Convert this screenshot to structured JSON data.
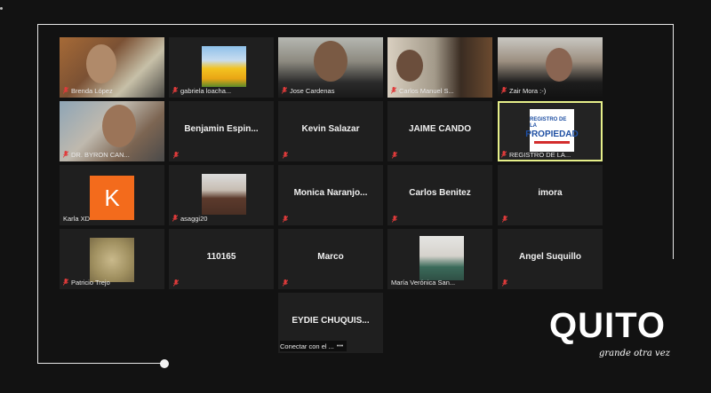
{
  "participants": [
    {
      "name": "Brenda López",
      "display": "",
      "muted": true
    },
    {
      "name": "gabriela loacha...",
      "display": "",
      "muted": true
    },
    {
      "name": "Jose Cardenas",
      "display": "",
      "muted": true
    },
    {
      "name": "Carlos Manuel S...",
      "display": "",
      "muted": true
    },
    {
      "name": "Zair Mora :-)",
      "display": "",
      "muted": true
    },
    {
      "name": "DR. BYRON CAN...",
      "display": "",
      "muted": true
    },
    {
      "name": "",
      "display": "Benjamin  Espin...",
      "muted": true
    },
    {
      "name": "",
      "display": "Kevin Salazar",
      "muted": true
    },
    {
      "name": "",
      "display": "JAIME CANDO",
      "muted": true
    },
    {
      "name": "REGISTRO DE LA...",
      "display": "",
      "muted": true,
      "active_speaker": true
    },
    {
      "name": "Karla XD",
      "display": "",
      "muted": false
    },
    {
      "name": "asaggi20",
      "display": "",
      "muted": true
    },
    {
      "name": "",
      "display": "Monica  Naranjo...",
      "muted": true
    },
    {
      "name": "",
      "display": "Carlos Benitez",
      "muted": true
    },
    {
      "name": "",
      "display": "imora",
      "muted": true
    },
    {
      "name": "Patricio Trejo",
      "display": "",
      "muted": true
    },
    {
      "name": "",
      "display": "110165",
      "muted": true
    },
    {
      "name": "",
      "display": "Marco",
      "muted": true
    },
    {
      "name": "María Verónica San...",
      "display": "",
      "muted": false
    },
    {
      "name": "",
      "display": "Angel Suquillo",
      "muted": true
    },
    {
      "name": "Conectar con el ...",
      "display": "EYDIE  CHUQUIS...",
      "muted": false
    }
  ],
  "avatar_letter": "K",
  "logo_text": {
    "line1": "REGISTRO DE LA",
    "line2": "PROPIEDAD"
  },
  "brand": {
    "word": "QUITO",
    "tagline": "grande otra vez"
  },
  "colors": {
    "background": "#121212",
    "tile": "#1f1f1f",
    "active_border": "#e6ef8a",
    "mic_muted": "#e03b3b",
    "avatar_bg": "#f36b1c"
  }
}
